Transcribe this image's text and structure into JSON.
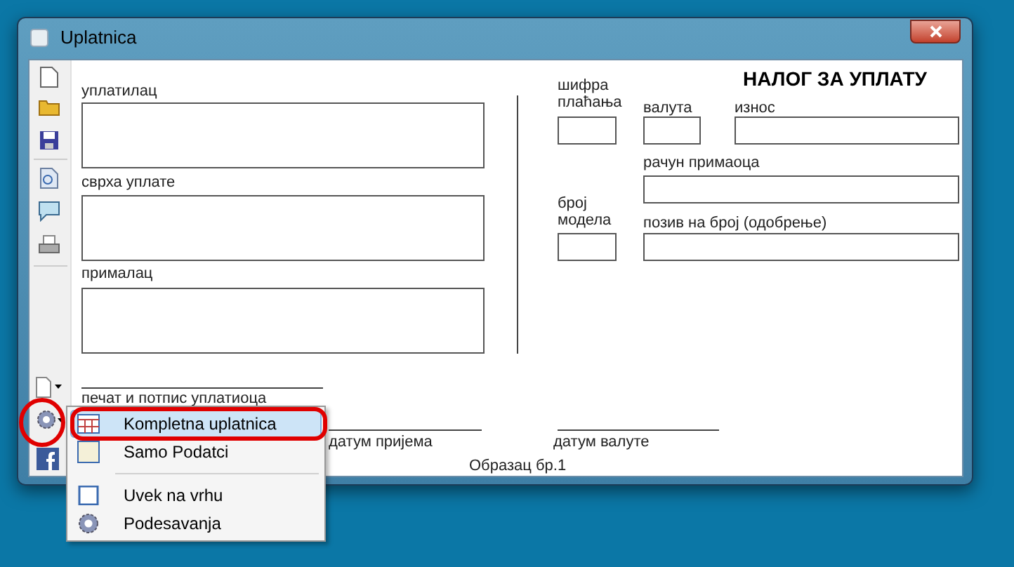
{
  "window": {
    "title": "Uplatnica"
  },
  "form": {
    "heading": "НАЛОГ ЗА УПЛАТУ",
    "payer_label": "уплатилац",
    "purpose_label": "сврха уплате",
    "recipient_label": "прималац",
    "payment_code_label": "шифра плаћања",
    "currency_label": "валута",
    "amount_label": "износ",
    "recipient_account_label": "рачун примаоца",
    "model_label": "број модела",
    "reference_label": "позив на број (одобрење)",
    "signature_label": "печат и потпис уплатиоца",
    "received_date_label": "датум пријема",
    "value_date_label": "датум валуте",
    "form_number": "Образац бр.1"
  },
  "menu": {
    "groups": [
      [
        {
          "label": "Kompletna uplatnica",
          "selected": true
        },
        {
          "label": "Samo Podatci",
          "selected": false
        }
      ],
      [
        {
          "label": "Uvek na vrhu",
          "selected": false
        },
        {
          "label": "Podesavanja",
          "selected": false
        }
      ]
    ]
  }
}
